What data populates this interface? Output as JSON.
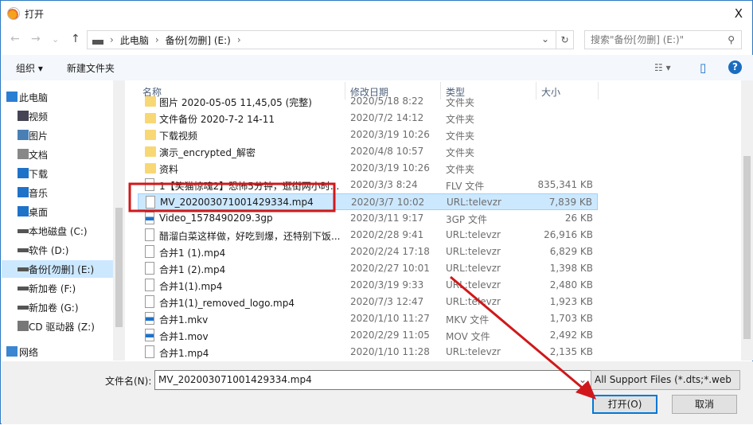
{
  "title": "打开",
  "close": "X",
  "nav": {
    "back": "←",
    "forward": "→",
    "recent": "⌄",
    "up": "↑",
    "breadcrumb": [
      "此电脑",
      "备份[勿删] (E:)"
    ],
    "sep": "›",
    "dropdown": "⌄",
    "refresh": "↻",
    "search_placeholder": "搜索\"备份[勿删] (E:)\"",
    "search_icon": "⚲"
  },
  "toolbar": {
    "organize": "组织 ▾",
    "new_folder": "新建文件夹",
    "view": "☷ ▾",
    "pane": "▯",
    "help": "?"
  },
  "sidebar": [
    {
      "label": "此电脑",
      "icon": "pc-icon"
    },
    {
      "label": "视频",
      "icon": "video-icon"
    },
    {
      "label": "图片",
      "icon": "picture-icon"
    },
    {
      "label": "文档",
      "icon": "document-icon"
    },
    {
      "label": "下载",
      "icon": "download-icon"
    },
    {
      "label": "音乐",
      "icon": "music-icon"
    },
    {
      "label": "桌面",
      "icon": "desktop-icon"
    },
    {
      "label": "本地磁盘 (C:)",
      "icon": "drive-icon"
    },
    {
      "label": "软件 (D:)",
      "icon": "drive-icon"
    },
    {
      "label": "备份[勿删] (E:)",
      "icon": "drive-icon",
      "selected": true
    },
    {
      "label": "新加卷 (F:)",
      "icon": "drive-icon"
    },
    {
      "label": "新加卷 (G:)",
      "icon": "drive-icon"
    },
    {
      "label": "CD 驱动器 (Z:)",
      "icon": "cd-icon"
    },
    {
      "label": "网络",
      "icon": "network-icon"
    }
  ],
  "columns": {
    "name": "名称",
    "date": "修改日期",
    "type": "类型",
    "size": "大小"
  },
  "files": [
    {
      "name": "图片 2020-05-05 11,45,05 (完整)",
      "date": "2020/5/18 8:22",
      "type": "文件夹",
      "size": "",
      "kind": "folder"
    },
    {
      "name": "文件备份 2020-7-2 14-11",
      "date": "2020/7/2 14:12",
      "type": "文件夹",
      "size": "",
      "kind": "folder"
    },
    {
      "name": "下载视频",
      "date": "2020/3/19 10:26",
      "type": "文件夹",
      "size": "",
      "kind": "folder"
    },
    {
      "name": "演示_encrypted_解密",
      "date": "2020/4/8 10:57",
      "type": "文件夹",
      "size": "",
      "kind": "folder"
    },
    {
      "name": "资料",
      "date": "2020/3/19 10:26",
      "type": "文件夹",
      "size": "",
      "kind": "folder"
    },
    {
      "name": "1【笑猫惊魂2】恐怖5分钟，逛街两小时...",
      "date": "2020/3/3 8:24",
      "type": "FLV 文件",
      "size": "835,341 KB",
      "kind": "file"
    },
    {
      "name": "MV_20200307100142933​4.mp4",
      "date": "2020/3/7 10:02",
      "type": "URL:televzr",
      "size": "7,839 KB",
      "kind": "file",
      "selected": true
    },
    {
      "name": "Video_1578490209.3gp",
      "date": "2020/3/11 9:17",
      "type": "3GP 文件",
      "size": "26 KB",
      "kind": "video"
    },
    {
      "name": "醋溜白菜这样做，好吃到爆，还特别下饭...",
      "date": "2020/2/28 9:41",
      "type": "URL:televzr",
      "size": "26,916 KB",
      "kind": "file"
    },
    {
      "name": "合并1 (1).mp4",
      "date": "2020/2/24 17:18",
      "type": "URL:televzr",
      "size": "6,829 KB",
      "kind": "file"
    },
    {
      "name": "合并1 (2).mp4",
      "date": "2020/2/27 10:01",
      "type": "URL:televzr",
      "size": "1,398 KB",
      "kind": "file"
    },
    {
      "name": "合并1(1).mp4",
      "date": "2020/3/19 9:33",
      "type": "URL:televzr",
      "size": "2,480 KB",
      "kind": "file"
    },
    {
      "name": "合并1(1)_removed_logo.mp4",
      "date": "2020/7/3 12:47",
      "type": "URL:televzr",
      "size": "1,923 KB",
      "kind": "file"
    },
    {
      "name": "合并1.mkv",
      "date": "2020/1/10 11:27",
      "type": "MKV 文件",
      "size": "1,703 KB",
      "kind": "video"
    },
    {
      "name": "合并1.mov",
      "date": "2020/2/29 11:05",
      "type": "MOV 文件",
      "size": "2,492 KB",
      "kind": "video"
    },
    {
      "name": "合并1.mp4",
      "date": "2020/1/10 11:28",
      "type": "URL:televzr",
      "size": "2,135 KB",
      "kind": "file"
    }
  ],
  "bottom": {
    "filename_label": "文件名(N):",
    "filename_value": "MV_202003071001429334.mp4",
    "filter": "All Support Files (*.dts;*.web",
    "open": "打开(O)",
    "cancel": "取消"
  },
  "colors": {
    "accent": "#0078d7",
    "selection": "#cce8ff",
    "annotation": "#d0181b"
  }
}
